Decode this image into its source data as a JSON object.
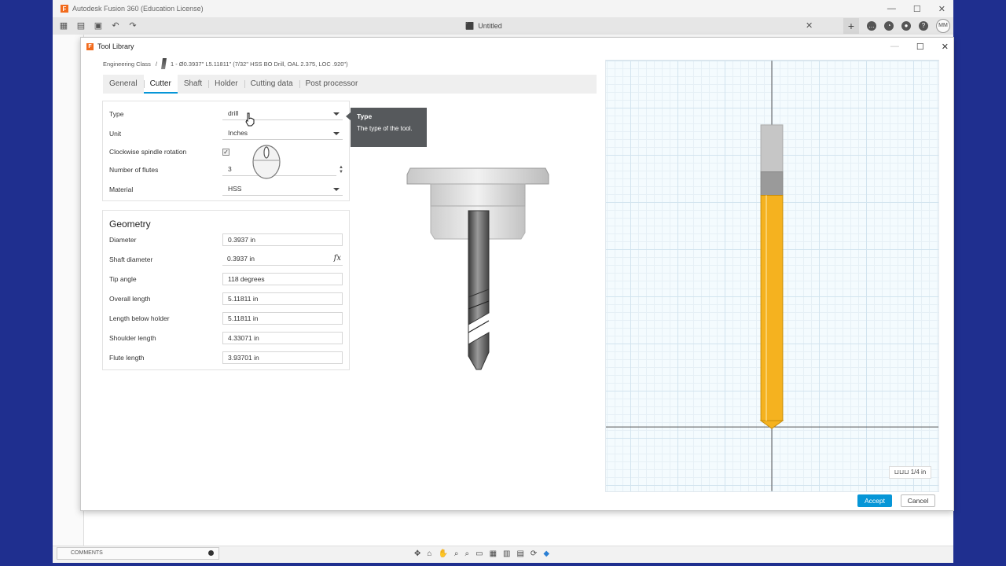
{
  "app": {
    "title": "Autodesk Fusion 360 (Education License)",
    "document_tab": "Untitled",
    "user_initials": "MM"
  },
  "dialog": {
    "title": "Tool Library",
    "breadcrumb": {
      "library": "Engineering Class",
      "separator": "/",
      "tool": "1 - Ø0.3937\" L5.11811\" (7/32\" HSS BO Drill, OAL 2.375, LOC .920\")"
    },
    "tabs": [
      {
        "label": "General",
        "active": false
      },
      {
        "label": "Cutter",
        "active": true
      },
      {
        "label": "Shaft",
        "active": false
      },
      {
        "label": "Holder",
        "active": false
      },
      {
        "label": "Cutting data",
        "active": false
      },
      {
        "label": "Post processor",
        "active": false
      }
    ],
    "cutter": {
      "type_label": "Type",
      "type_value": "drill",
      "unit_label": "Unit",
      "unit_value": "Inches",
      "clockwise_label": "Clockwise spindle rotation",
      "clockwise_checked": true,
      "flutes_label": "Number of flutes",
      "flutes_value": "3",
      "material_label": "Material",
      "material_value": "HSS"
    },
    "geometry": {
      "title": "Geometry",
      "fields": [
        {
          "label": "Diameter",
          "value": "0.3937 in"
        },
        {
          "label": "Shaft diameter",
          "value": "0.3937 in"
        },
        {
          "label": "Tip angle",
          "value": "118 degrees"
        },
        {
          "label": "Overall length",
          "value": "5.11811 in"
        },
        {
          "label": "Length below holder",
          "value": "5.11811 in"
        },
        {
          "label": "Shoulder length",
          "value": "4.33071 in"
        },
        {
          "label": "Flute length",
          "value": "3.93701 in"
        }
      ],
      "fx_label": "fx"
    },
    "tooltip": {
      "title": "Type",
      "body": "The type of the tool."
    },
    "scale_label": "1/4 in",
    "accept_label": "Accept",
    "cancel_label": "Cancel"
  },
  "bottom": {
    "comments_label": "COMMENTS"
  },
  "colors": {
    "accent": "#0696d7",
    "tool_body": "#f5b21f",
    "holder_gray": "#bdbdbd"
  }
}
